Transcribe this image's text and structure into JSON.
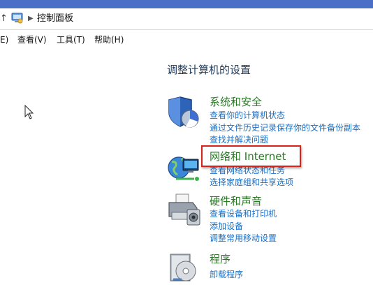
{
  "address_bar": {
    "up_icon": "up-arrow-icon",
    "location_icon": "control-panel-icon",
    "separator_icon": "chevron-right-icon",
    "location": "控制面板"
  },
  "menu": {
    "items": [
      {
        "label": "E)"
      },
      {
        "label": "查看(V)"
      },
      {
        "label": "工具(T)"
      },
      {
        "label": "帮助(H)"
      }
    ]
  },
  "main": {
    "heading": "调整计算机的设置",
    "categories": [
      {
        "icon": "shield-icon",
        "title": "系统和安全",
        "links": [
          "查看你的计算机状态",
          "通过文件历史记录保存你的文件备份副本",
          "查找并解决问题"
        ]
      },
      {
        "icon": "network-globe-icon",
        "title": "网络和 Internet",
        "highlighted": true,
        "links": [
          "查看网络状态和任务",
          "选择家庭组和共享选项"
        ]
      },
      {
        "icon": "printer-icon",
        "title": "硬件和声音",
        "links": [
          "查看设备和打印机",
          "添加设备",
          "调整常用移动设置"
        ]
      },
      {
        "icon": "programs-icon",
        "title": "程序",
        "links": [
          "卸载程序"
        ]
      }
    ]
  },
  "colors": {
    "title_bar": "#4b6fc7",
    "category_title": "#2a7a25",
    "link": "#1a6fc7",
    "highlight_border": "#d8231b"
  }
}
